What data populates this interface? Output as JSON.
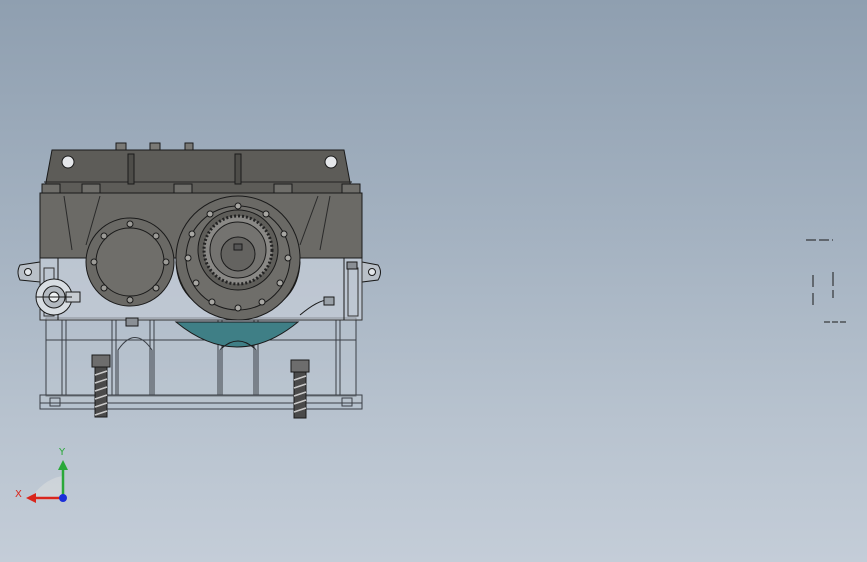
{
  "viewport": {
    "background_top": "#8f9fb0",
    "background_bottom": "#c4cdd8"
  },
  "model": {
    "housing_color": "#6b6a66",
    "cover_color": "#5d5c58",
    "flange_accent": "#b5a832",
    "oil_level_color": "#3f7f86",
    "line_color": "#1a1a1a"
  },
  "triad": {
    "x_label": "X",
    "y_label": "Y",
    "x_color": "#d9261c",
    "y_color": "#2aa83a",
    "z_color": "#1b2fd9"
  }
}
